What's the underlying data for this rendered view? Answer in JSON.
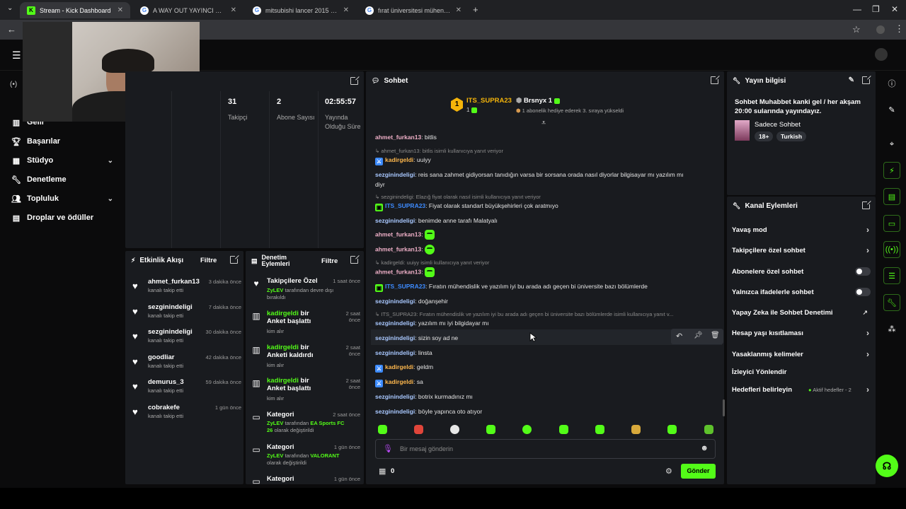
{
  "browser": {
    "tabs": [
      {
        "title": "Stream - Kick Dashboard",
        "favicon": "K"
      },
      {
        "title": "A WAY OUT YAYINCI MODU - G",
        "favicon": "G"
      },
      {
        "title": "mitsubishi lancer 2015 - Googl",
        "favicon": "G"
      },
      {
        "title": "fırat üniversitesi mühendisliği D",
        "favicon": "G"
      }
    ],
    "new_tab": "+"
  },
  "sidebar": {
    "items": [
      {
        "label": "Gelir",
        "icon": "chart-icon"
      },
      {
        "label": "Başarılar",
        "icon": "trophy-icon"
      },
      {
        "label": "Stüdyo",
        "icon": "grid-icon",
        "expandable": true
      },
      {
        "label": "Denetleme",
        "icon": "wrench-icon"
      },
      {
        "label": "Topluluk",
        "icon": "users-icon",
        "expandable": true
      },
      {
        "label": "Droplar ve ödüller",
        "icon": "gift-icon"
      }
    ]
  },
  "stats": [
    {
      "value": "31",
      "label": "Takipçi"
    },
    {
      "value": "2",
      "label": "Abone Sayısı"
    },
    {
      "value": "02:55:57",
      "label": "Yayında Olduğu Süre"
    }
  ],
  "activity": {
    "title": "Etkinlik Akışı",
    "filter": "Filtre",
    "rows": [
      {
        "name": "ahmet_furkan13",
        "sub": "kanalı takip etti",
        "time": "3 dakika önce"
      },
      {
        "name": "sezginindeligi",
        "sub": "kanalı takip etti",
        "time": "7 dakika önce"
      },
      {
        "name": "sezginindeligi",
        "sub": "kanalı takip etti",
        "time": "30 dakika önce"
      },
      {
        "name": "goodliar",
        "sub": "kanalı takip etti",
        "time": "42 dakika önce"
      },
      {
        "name": "demurus_3",
        "sub": "kanalı takip etti",
        "time": "59 dakika önce"
      },
      {
        "name": "cobrakefe",
        "sub": "kanalı takip etti",
        "time": "1 gün önce"
      }
    ]
  },
  "moderation": {
    "title_line1": "Denetim",
    "title_line2": "Eylemleri",
    "filter": "Filtre",
    "rows": [
      {
        "title": "Takipçilere Özel",
        "who": "ZyLEV",
        "text": "tarafından devre dışı bırakıldı",
        "time": "1 saat önce",
        "icon": "heart-icon"
      },
      {
        "title_user": "kadirgeldi",
        "title": "bir Anket başlattı",
        "text": "kim alır",
        "time": "2 saat önce",
        "icon": "poll-icon"
      },
      {
        "title_user": "kadirgeldi",
        "title": "bir Anketi kaldırdı",
        "text": "kim alır",
        "time": "2 saat önce",
        "icon": "poll-icon"
      },
      {
        "title_user": "kadirgeldi",
        "title": "bir Anket başlattı",
        "text": "kim alır",
        "time": "2 saat önce",
        "icon": "poll-icon"
      },
      {
        "title": "Kategori",
        "who": "ZyLEV",
        "text": "tarafından",
        "highlight": "EA Sports FC 26",
        "text2": "olarak değiştirildi",
        "time": "2 saat önce",
        "icon": "category-icon"
      },
      {
        "title": "Kategori",
        "who": "ZyLEV",
        "text": "tarafından",
        "highlight": "VALORANT",
        "text2": "olarak değiştirildi",
        "time": "1 gün önce",
        "icon": "category-icon"
      },
      {
        "title": "Kategori",
        "time": "1 gün önce",
        "icon": "category-icon"
      }
    ]
  },
  "chat": {
    "title": "Sohbet",
    "top_gifter": {
      "rank": "1",
      "name": "ITS_SUPRA23",
      "count": "1"
    },
    "gift_user": "Brsnyx",
    "gift_count": "1",
    "gift_text": "1 abonelik hediye ederek 3. sıraya yükseldi",
    "messages": [
      {
        "type": "msg",
        "user": "ahmet_furkan13",
        "text": ": bitlis",
        "color": "#f0b0c8"
      },
      {
        "type": "reply",
        "text": "ahmet_furkan13: bitlis isimli kullanıcıya yanıt veriyor"
      },
      {
        "type": "msg",
        "user": "kadirgeldi",
        "text": ": uuiyy",
        "color": "#ffb84d",
        "badge": "mod"
      },
      {
        "type": "msg",
        "user": "sezginindeligi",
        "text": ": reis sana zahmet gidiyorsan tanıdığın varsa bir sorsana orada nasıl diyorlar bilgisayar mı yazılım mı",
        "color": "#a9c8ff"
      },
      {
        "type": "cont",
        "text": "diyr"
      },
      {
        "type": "reply",
        "text": "sezginindeligi: Elazığ fiyat olarak nasıl isimli kullanıcıya yanıt veriyor"
      },
      {
        "type": "msg",
        "user": "ITS_SUPRA23",
        "text": ": Fiyat olarak standart büyükşehirleri çok aratmıyo",
        "color": "#3d8bff",
        "badge": "sub"
      },
      {
        "type": "msg",
        "user": "sezginindeligi",
        "text": ": benimde anne tarafı Malatyalı",
        "color": "#a9c8ff"
      },
      {
        "type": "msg",
        "user": "ahmet_furkan13",
        "text": ":",
        "color": "#f0b0c8",
        "emote": true
      },
      {
        "type": "msg",
        "user": "ahmet_furkan13",
        "text": ":",
        "color": "#f0b0c8",
        "emote": true
      },
      {
        "type": "reply",
        "text": "kadirgeldi: uuiyy isimli kullanıcıya yanıt veriyor"
      },
      {
        "type": "msg",
        "user": "ahmet_furkan13",
        "text": ":",
        "color": "#f0b0c8",
        "emote": true
      },
      {
        "type": "msg",
        "user": "ITS_SUPRA23",
        "text": ": Fıratın mühendislik ve yazılım iyi bu arada adı geçen bi üniversite bazı bölümlerde",
        "color": "#3d8bff",
        "badge": "sub"
      },
      {
        "type": "msg",
        "user": "sezginindeligi",
        "text": ": doğanşehir",
        "color": "#a9c8ff"
      },
      {
        "type": "reply",
        "text": "ITS_SUPRA23: Fıratın mühendislik ve yazılım iyi bu arada adı geçen bi üniversite bazı bölümlerde isimli kullanıcıya yanıt v..."
      },
      {
        "type": "msg",
        "user": "sezginindeligi",
        "text": ": yazılım mı iyi bilgidayar mı",
        "color": "#a9c8ff"
      },
      {
        "type": "msg",
        "user": "sezginindeligi",
        "text": ": sizin soy ad ne",
        "color": "#a9c8ff"
      },
      {
        "type": "msg",
        "user": "sezginindeligi",
        "text": ": linsta",
        "color": "#a9c8ff"
      },
      {
        "type": "msg",
        "user": "kadirgeldi",
        "text": ": geldm",
        "color": "#ffb84d",
        "badge": "mod"
      },
      {
        "type": "msg",
        "user": "kadirgeldi",
        "text": ": sa",
        "color": "#ffb84d",
        "badge": "mod"
      },
      {
        "type": "msg",
        "user": "sezginindeligi",
        "text": ": botrix kurmadınız mı",
        "color": "#a9c8ff"
      },
      {
        "type": "msg",
        "user": "sezginindeligi",
        "text": ": böyle yapınca oto atıyor",
        "color": "#a9c8ff"
      }
    ],
    "input_placeholder": "Bir mesaj gönderin",
    "points": "0",
    "send_label": "Gönder"
  },
  "stream_info": {
    "title": "Yayın bilgisi",
    "description": "Sohbet Muhabbet kanki gel / her akşam 20:00 sularında yayındayız.",
    "category": "Sadece Sohbet",
    "tags": [
      "18+",
      "Turkish"
    ]
  },
  "channel_actions": {
    "title": "Kanal Eylemleri",
    "items": [
      {
        "label": "Yavaş mod",
        "control": "chevron"
      },
      {
        "label": "Takipçilere özel sohbet",
        "control": "chevron"
      },
      {
        "label": "Abonelere özel sohbet",
        "control": "toggle"
      },
      {
        "label": "Yalnızca ifadelerle sohbet",
        "control": "toggle"
      },
      {
        "label": "Yapay Zeka ile Sohbet Denetimi",
        "control": "external"
      },
      {
        "label": "Hesap yaşı kısıtlaması",
        "control": "chevron"
      },
      {
        "label": "Yasaklanmış kelimeler",
        "control": "chevron"
      },
      {
        "label": "İzleyici Yönlendir",
        "control": "none"
      },
      {
        "label": "Hedefleri belirleyin",
        "control": "chevron",
        "extra": "Aktif hedefler - 2"
      }
    ]
  },
  "colors": {
    "accent": "#53fc18",
    "panel": "#191b1f",
    "bg": "#0b0b0c"
  }
}
